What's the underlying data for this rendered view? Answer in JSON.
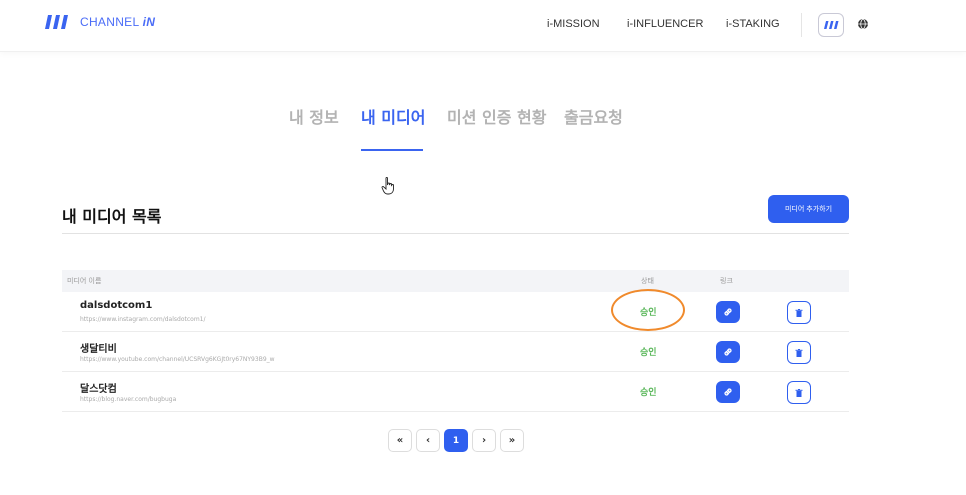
{
  "header": {
    "logo_text": "CHANNEL",
    "logo_text_bold": "iN",
    "nav": [
      "i-MISSION",
      "i-INFLUENCER",
      "i-STAKING"
    ],
    "brand_color": "#3a64f0"
  },
  "tabs": [
    {
      "label": "내 정보",
      "active": false
    },
    {
      "label": "내 미디어",
      "active": true
    },
    {
      "label": "미션 인증 현황",
      "active": false
    },
    {
      "label": "출금요청",
      "active": false
    }
  ],
  "section": {
    "title": "내 미디어 목록",
    "add_button": "미디어 추가하기"
  },
  "table": {
    "headers": {
      "name": "미디어 이름",
      "status": "상태",
      "link": "링크"
    },
    "rows": [
      {
        "name": "dalsdotcom1",
        "url": "https://www.instagram.com/dalsdotcom1/",
        "status": "승인"
      },
      {
        "name": "생달티비",
        "url": "https://www.youtube.com/channel/UCSRVg6KGJt0ry67NY93B9_w",
        "status": "승인"
      },
      {
        "name": "달스닷컴",
        "url": "https://blog.naver.com/bugbuga",
        "status": "승인"
      }
    ]
  },
  "pagination": {
    "first": "«",
    "prev": "‹",
    "current": "1",
    "next": "›",
    "last": "»"
  },
  "colors": {
    "primary": "#2f5fef",
    "status_green": "#5cb85c",
    "highlight": "#f08a2c"
  }
}
